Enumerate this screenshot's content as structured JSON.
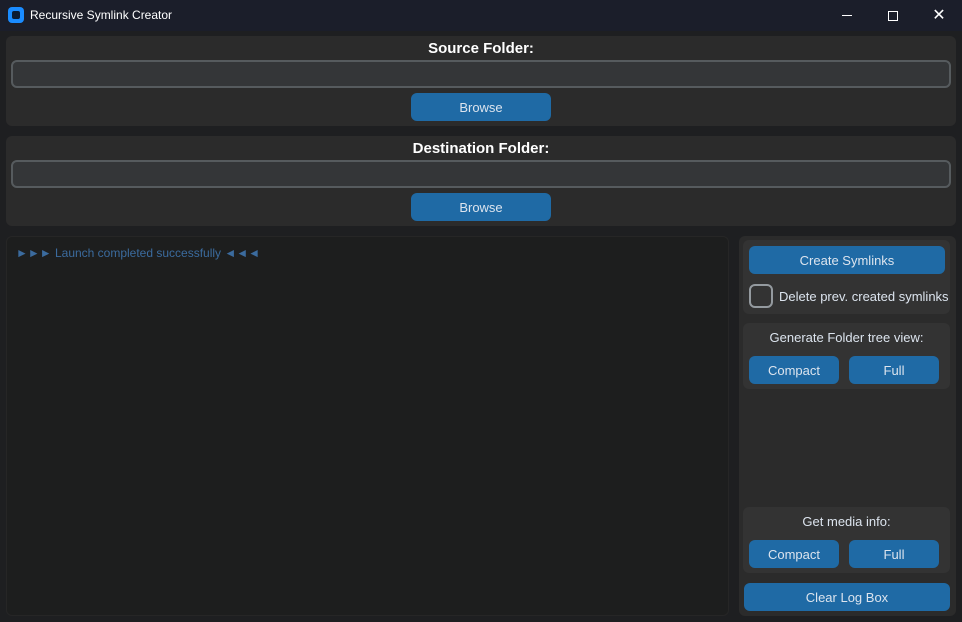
{
  "window": {
    "title": "Recursive Symlink Creator"
  },
  "source": {
    "label": "Source Folder:",
    "value": "",
    "browse_label": "Browse"
  },
  "destination": {
    "label": "Destination Folder:",
    "value": "",
    "browse_label": "Browse"
  },
  "log": {
    "lines": [
      "►►► Launch completed successfully ◄◄◄"
    ]
  },
  "actions": {
    "create_label": "Create Symlinks",
    "delete_prev": {
      "label": "Delete prev. created symlinks",
      "checked": false
    }
  },
  "tree_view": {
    "label": "Generate Folder tree view:",
    "compact_label": "Compact",
    "full_label": "Full"
  },
  "media_info": {
    "label": "Get media info:",
    "compact_label": "Compact",
    "full_label": "Full"
  },
  "clear_log_label": "Clear Log Box",
  "colors": {
    "accent": "#1f6aa5",
    "background": "#1e1f21",
    "frame": "#2b2b2b",
    "log_text": "#3b6b9e"
  }
}
